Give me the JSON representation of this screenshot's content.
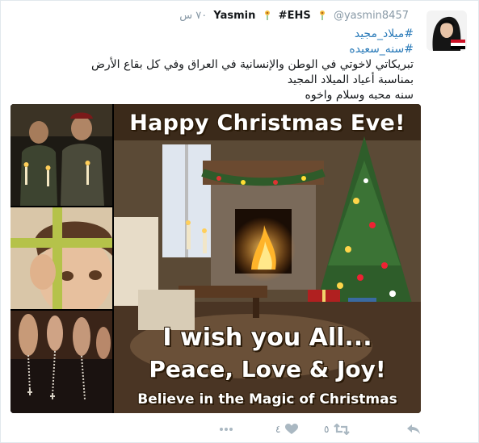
{
  "user": {
    "name": "Yasmin",
    "hashtag_name": "#EHS",
    "handle": "@yasmin8457",
    "time": "٧٠ س"
  },
  "tweet": {
    "hashtag1": "#ميلاد_مجيد",
    "hashtag2": "#سنه_سعيده",
    "line1": "تبريكاتي لاخوتي في الوطن والإنسانية في العراق وفي كل بقاع الأرض",
    "line2": "بمناسبة أعياد الميلاد المجيد",
    "line3": "سنه محبه وسلام واخوه"
  },
  "image": {
    "caption_top": "Happy Christmas Eve!",
    "caption_mid1": "I wish you All...",
    "caption_mid2": "Peace, Love & Joy!",
    "caption_bottom": "Believe in the Magic of Christmas"
  },
  "actions": {
    "retweet_count": "٥",
    "like_count": "٤"
  },
  "colors": {
    "link": "#2b7bb9",
    "muted": "#8899a6",
    "icon": "#aab8c2"
  }
}
